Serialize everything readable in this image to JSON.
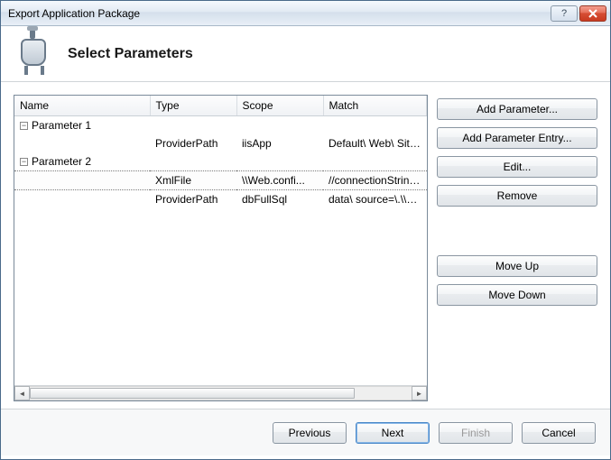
{
  "window": {
    "title": "Export Application Package"
  },
  "header": {
    "title": "Select Parameters"
  },
  "columns": {
    "name": "Name",
    "type": "Type",
    "scope": "Scope",
    "match": "Match"
  },
  "rows": {
    "p1": {
      "name": "Parameter 1",
      "type": "",
      "scope": "",
      "match": ""
    },
    "p1child": {
      "name": "",
      "type": "ProviderPath",
      "scope": "iisApp",
      "match": "Default\\ Web\\ Site/M"
    },
    "p2": {
      "name": "Parameter 2",
      "type": "",
      "scope": "",
      "match": ""
    },
    "p2child1": {
      "name": "",
      "type": "XmlFile",
      "scope": "\\\\Web.confi...",
      "match": "//connectionStrings/"
    },
    "p2child2": {
      "name": "",
      "type": "ProviderPath",
      "scope": "dbFullSql",
      "match": "data\\ source=\\.\\\\SQ"
    }
  },
  "buttons": {
    "addParam": "Add Parameter...",
    "addEntry": "Add Parameter Entry...",
    "edit": "Edit...",
    "remove": "Remove",
    "moveUp": "Move Up",
    "moveDown": "Move Down",
    "previous": "Previous",
    "next": "Next",
    "finish": "Finish",
    "cancel": "Cancel"
  }
}
